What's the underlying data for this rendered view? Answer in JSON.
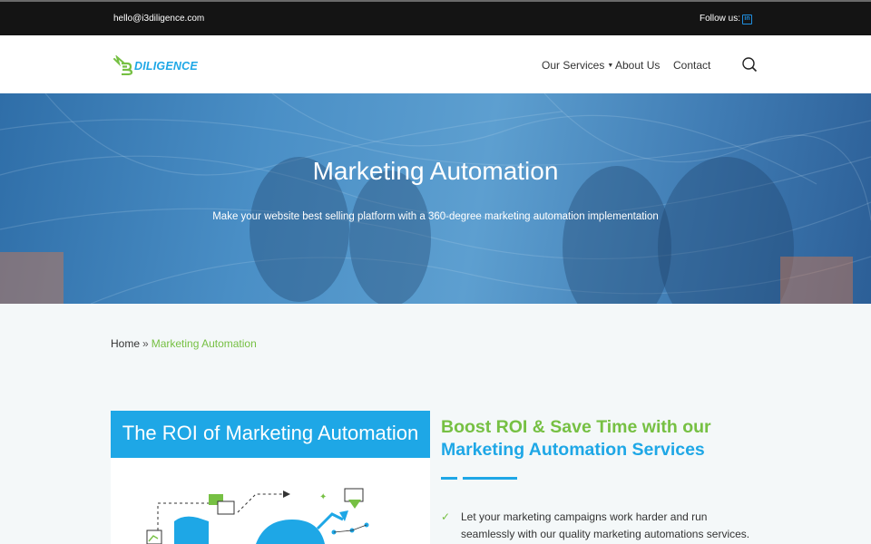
{
  "topbar": {
    "email": "hello@i3diligence.com",
    "follow_label": "Follow us:",
    "social_icon": "linkedin-icon"
  },
  "header": {
    "logo_text": "DILIGENCE",
    "nav": {
      "services": "Our Services",
      "about": "About Us",
      "contact": "Contact"
    },
    "search_icon": "search-icon"
  },
  "hero": {
    "title": "Marketing Automation",
    "subtitle": "Make your website best selling platform with a 360-degree marketing automation implementation"
  },
  "breadcrumb": {
    "home": "Home",
    "separator": "»",
    "current": "Marketing Automation"
  },
  "roi_image": {
    "title": "The ROI of Marketing Automation"
  },
  "content": {
    "heading_green": "Boost ROI & Save Time with our",
    "heading_blue": "Marketing Automation Services",
    "features": [
      "Let your marketing campaigns work harder and run seamlessly with our quality marketing automations services."
    ]
  },
  "colors": {
    "accent_blue": "#1ea7e6",
    "accent_green": "#76c043",
    "topbar_bg": "#141414"
  }
}
